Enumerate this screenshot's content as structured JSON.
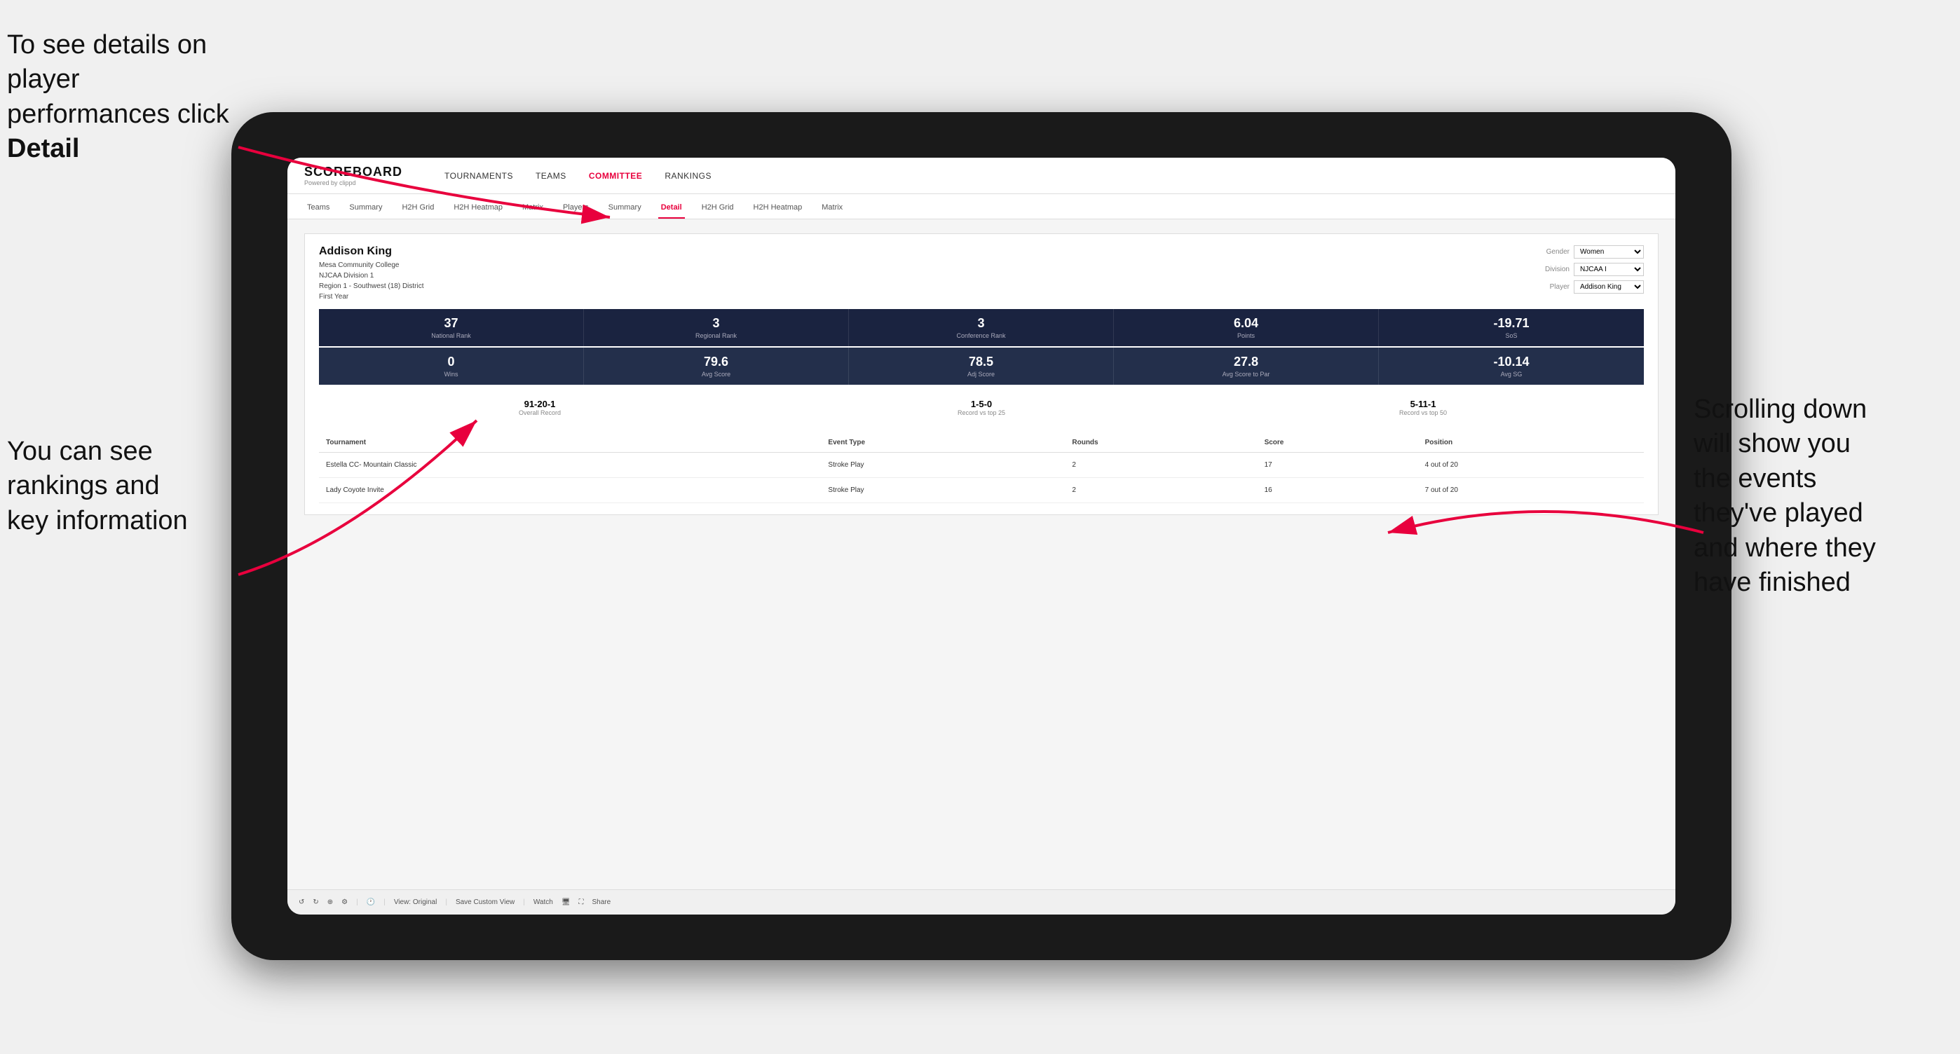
{
  "annotations": {
    "top_left": "To see details on player performances click ",
    "top_left_bold": "Detail",
    "bottom_left_line1": "You can see",
    "bottom_left_line2": "rankings and",
    "bottom_left_line3": "key information",
    "right_line1": "Scrolling down",
    "right_line2": "will show you",
    "right_line3": "the events",
    "right_line4": "they've played",
    "right_line5": "and where they",
    "right_line6": "have finished"
  },
  "nav": {
    "logo": "SCOREBOARD",
    "logo_sub": "Powered by clippd",
    "links": [
      "TOURNAMENTS",
      "TEAMS",
      "COMMITTEE",
      "RANKINGS"
    ]
  },
  "sub_nav": {
    "tabs": [
      "Teams",
      "Summary",
      "H2H Grid",
      "H2H Heatmap",
      "Matrix",
      "Players",
      "Summary",
      "Detail",
      "H2H Grid",
      "H2H Heatmap",
      "Matrix"
    ]
  },
  "player": {
    "name": "Addison King",
    "college": "Mesa Community College",
    "division": "NJCAA Division 1",
    "region": "Region 1 - Southwest (18) District",
    "year": "First Year",
    "gender_label": "Gender",
    "gender_value": "Women",
    "division_label": "Division",
    "division_value": "NJCAA I",
    "player_label": "Player",
    "player_value": "Addison King"
  },
  "stats_row1": [
    {
      "value": "37",
      "label": "National Rank"
    },
    {
      "value": "3",
      "label": "Regional Rank"
    },
    {
      "value": "3",
      "label": "Conference Rank"
    },
    {
      "value": "6.04",
      "label": "Points"
    },
    {
      "value": "-19.71",
      "label": "SoS"
    }
  ],
  "stats_row2": [
    {
      "value": "0",
      "label": "Wins"
    },
    {
      "value": "79.6",
      "label": "Avg Score"
    },
    {
      "value": "78.5",
      "label": "Adj Score"
    },
    {
      "value": "27.8",
      "label": "Avg Score to Par"
    },
    {
      "value": "-10.14",
      "label": "Avg SG"
    }
  ],
  "records": [
    {
      "value": "91-20-1",
      "label": "Overall Record"
    },
    {
      "value": "1-5-0",
      "label": "Record vs top 25"
    },
    {
      "value": "5-11-1",
      "label": "Record vs top 50"
    }
  ],
  "table": {
    "headers": [
      "Tournament",
      "Event Type",
      "Rounds",
      "Score",
      "Position"
    ],
    "rows": [
      {
        "tournament": "Estella CC- Mountain Classic",
        "event_type": "Stroke Play",
        "rounds": "2",
        "score": "17",
        "position": "4 out of 20"
      },
      {
        "tournament": "Lady Coyote Invite",
        "event_type": "Stroke Play",
        "rounds": "2",
        "score": "16",
        "position": "7 out of 20"
      }
    ]
  },
  "toolbar": {
    "view_label": "View: Original",
    "save_label": "Save Custom View",
    "watch_label": "Watch",
    "share_label": "Share"
  }
}
